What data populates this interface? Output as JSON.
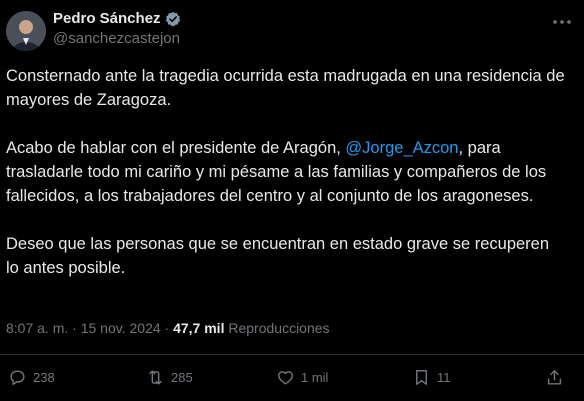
{
  "author": {
    "name": "Pedro Sánchez",
    "handle": "@sanchezcastejon"
  },
  "tweet": {
    "paragraph1": "Consternado ante la tragedia ocurrida esta madrugada en una residencia de mayores de Zaragoza.",
    "paragraph2_before": "Acabo de hablar con el presidente de Aragón, ",
    "mention": "@Jorge_Azcon",
    "paragraph2_after": ", para trasladarle todo mi cariño y mi pésame a las familias y compañeros de los fallecidos, a los trabajadores del centro y al conjunto de los aragoneses.",
    "paragraph3": "Deseo que las personas que se encuentran en estado grave se recuperen lo antes posible."
  },
  "meta": {
    "time": "8:07 a. m.",
    "separator": " · ",
    "date": "15 nov. 2024",
    "views_count": "47,7 mil",
    "views_label": "Reproducciones"
  },
  "actions": {
    "replies": "238",
    "retweets": "285",
    "likes": "1 mil",
    "bookmarks": "11"
  },
  "colors": {
    "background": "#000000",
    "text": "#e7e9ea",
    "muted": "#71767b",
    "accent": "#1d9bf0"
  },
  "icons": [
    "verified-badge-icon",
    "more-icon",
    "reply-icon",
    "retweet-icon",
    "like-icon",
    "bookmark-icon",
    "share-icon"
  ]
}
